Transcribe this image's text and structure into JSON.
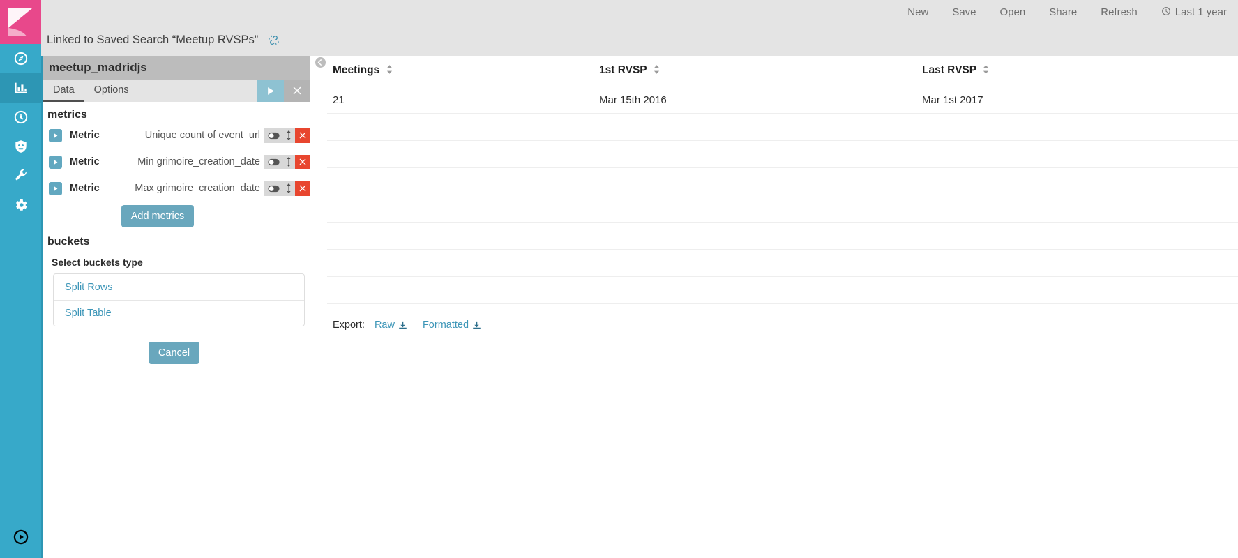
{
  "sidebar": {
    "logo_name": "kibana-logo",
    "items": [
      {
        "name": "discover",
        "icon": "compass-icon",
        "active": false
      },
      {
        "name": "visualize",
        "icon": "bar-chart-icon",
        "active": true
      },
      {
        "name": "timelion",
        "icon": "clock-dial-icon",
        "active": false
      },
      {
        "name": "dev-tools-console",
        "icon": "shield-icon",
        "active": false
      },
      {
        "name": "management-wrench",
        "icon": "wrench-icon",
        "active": false
      },
      {
        "name": "settings",
        "icon": "gear-icon",
        "active": false
      }
    ],
    "bottom_item": {
      "name": "collapse-nav",
      "icon": "play-circle-icon"
    }
  },
  "topbar": {
    "links": [
      {
        "label": "New",
        "icon": ""
      },
      {
        "label": "Save",
        "icon": ""
      },
      {
        "label": "Open",
        "icon": ""
      },
      {
        "label": "Share",
        "icon": ""
      },
      {
        "label": "Refresh",
        "icon": ""
      }
    ],
    "time_picker": {
      "label": "Last 1 year",
      "icon": "clock-icon"
    }
  },
  "linkbar": {
    "text": "Linked to Saved Search “Meetup RVSPs”",
    "icon": "unlink-icon"
  },
  "editor": {
    "title": "meetup_madridjs",
    "tabs": [
      {
        "label": "Data",
        "active": true
      },
      {
        "label": "Options",
        "active": false
      }
    ],
    "apply_icon": "play-icon",
    "discard_icon": "close-icon",
    "metrics_heading": "metrics",
    "metrics": [
      {
        "label": "Metric",
        "agg": "Unique count of event_url"
      },
      {
        "label": "Metric",
        "agg": "Min grimoire_creation_date"
      },
      {
        "label": "Metric",
        "agg": "Max grimoire_creation_date"
      }
    ],
    "add_metrics_label": "Add metrics",
    "buckets_heading": "buckets",
    "buckets_sub": "Select buckets type",
    "bucket_options": [
      {
        "label": "Split Rows"
      },
      {
        "label": "Split Table"
      }
    ],
    "cancel_label": "Cancel"
  },
  "table": {
    "columns": [
      {
        "label": "Meetings",
        "sortable": true
      },
      {
        "label": "1st RVSP",
        "sortable": true
      },
      {
        "label": "Last RVSP",
        "sortable": true
      }
    ],
    "rows": [
      [
        "21",
        "Mar 15th 2016",
        "Mar 1st 2017"
      ],
      [
        "",
        "",
        ""
      ],
      [
        "",
        "",
        ""
      ],
      [
        "",
        "",
        ""
      ],
      [
        "",
        "",
        ""
      ],
      [
        "",
        "",
        ""
      ],
      [
        "",
        "",
        ""
      ],
      [
        "",
        "",
        ""
      ]
    ]
  },
  "export": {
    "label": "Export:",
    "raw_label": "Raw",
    "formatted_label": "Formatted",
    "download_icon": "download-icon"
  },
  "colors": {
    "brand_pink": "#e8488b",
    "brand_teal": "#37a9c9",
    "accent_link": "#3d96b8",
    "danger": "#e8462f",
    "header_gray": "#e4e4e4",
    "panel_title_gray": "#bcbcbc"
  }
}
